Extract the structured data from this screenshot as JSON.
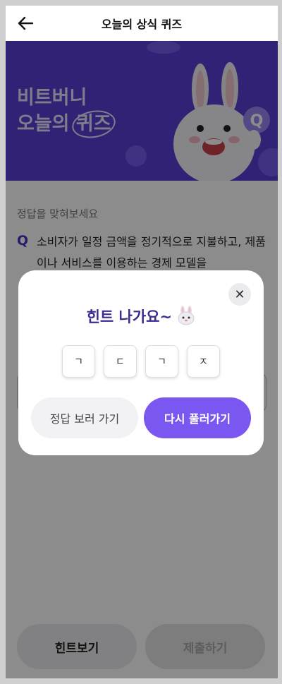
{
  "header": {
    "title": "오늘의 상식 퀴즈"
  },
  "banner": {
    "line1": "비트버니",
    "line2_prefix": "오늘의 ",
    "line2_highlight": "퀴즈"
  },
  "quiz": {
    "prompt": "정답을 맞혀보세요",
    "q_mark": "Q",
    "question": "소비자가 일정 금액을 정기적으로 지불하고, 제품이나 서비스를 이용하는 경제 모델을"
  },
  "bottom": {
    "hint_label": "힌트보기",
    "submit_label": "제출하기"
  },
  "modal": {
    "title": "힌트 나가요~",
    "hint_letters": [
      "ㄱ",
      "ㄷ",
      "ㄱ",
      "ㅈ"
    ],
    "show_answer_label": "정답 보러 가기",
    "retry_label": "다시 풀러가기"
  },
  "colors": {
    "brand": "#5a3fd6",
    "accent": "#7b57f2"
  }
}
